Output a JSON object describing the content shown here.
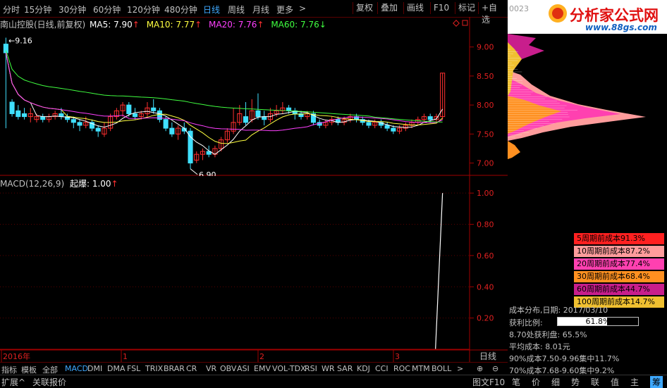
{
  "toolbar": {
    "periods": [
      "分时",
      "15分钟",
      "30分钟",
      "60分钟",
      "120分钟",
      "480分钟",
      "日线",
      "周线",
      "月线",
      "更多"
    ],
    "active_period": "日线",
    "buttons": [
      "复权",
      "叠加",
      "画线",
      "F10",
      "标记",
      "+自选"
    ],
    "code_partial": "0023"
  },
  "logo": {
    "text": "分析家公式网",
    "url": "www.88gs.com"
  },
  "main": {
    "title_name": "南山控股(日线,前复权)",
    "ma5": "MA5: 7.90",
    "ma10": "MA10: 7.77",
    "ma20": "MA20: 7.76",
    "ma60": "MA60: 7.76",
    "high_label": "9.16",
    "low_label": "6.90",
    "yaxis": [
      "9.00",
      "8.50",
      "8.00",
      "7.50",
      "7.00"
    ]
  },
  "macd": {
    "title": "MACD(12,26,9)",
    "indicator": "起爆: 1.00",
    "yaxis": [
      "1.00",
      "0.80",
      "0.60",
      "0.40",
      "0.20"
    ]
  },
  "dates": [
    "2016年",
    "1",
    "2",
    "3"
  ],
  "date_unit": "日线",
  "bottom_tabs": [
    "指标",
    "模板",
    "全部",
    "MACD",
    "DMI",
    "DMA",
    "FSL",
    "TRIX",
    "BRAR",
    "CR",
    "VR",
    "OBV",
    "ASI",
    "EMV",
    "VOL-TDX",
    "RSI",
    "WR",
    "SAR",
    "KDJ",
    "CCI",
    "ROC",
    "MTM",
    "BOLL"
  ],
  "active_tab": "MACD",
  "status_buttons": [
    "扩展^",
    "关联报价"
  ],
  "status_right": "图文F10",
  "right_tabs": [
    "笔",
    "价",
    "细",
    "势",
    "联",
    "值",
    "主",
    "筹"
  ],
  "active_right_tab": "筹",
  "cost_rows": [
    {
      "label": "5周期前成本91.3%",
      "color": "#ff2020"
    },
    {
      "label": "10周期前成本87.2%",
      "color": "#ff9c9c"
    },
    {
      "label": "20周期前成本77.4%",
      "color": "#ff40b0"
    },
    {
      "label": "30周期前成本68.4%",
      "color": "#ff9020"
    },
    {
      "label": "60周期前成本44.7%",
      "color": "#c81e8c"
    },
    {
      "label": "100周期前成本14.7%",
      "color": "#f0c030"
    }
  ],
  "cost_info": {
    "date": "成本分布,日期: 2017/03/10",
    "ratio_label": "获利比例:",
    "ratio_value": "61.8%",
    "ratio_fraction": 0.618,
    "profit": "8.70处获利盘: 65.5%",
    "avg": "平均成本: 8.01元",
    "c90": "90%成本7.50-9.96集中11.7%",
    "c70": "70%成本7.68-9.60集中9.2%"
  },
  "colors": {
    "up": "#ff3030",
    "down": "#40e0ff",
    "ma5": "#ffffff",
    "ma10": "#ffff40",
    "ma20": "#ff40ff",
    "ma60": "#40ff40",
    "axis": "#a00000"
  },
  "chart_data": {
    "type": "candlestick",
    "ylim": [
      6.8,
      9.3
    ],
    "candles": [
      [
        9.05,
        8.9,
        9.16,
        7.6
      ],
      [
        8.05,
        7.85,
        8.1,
        7.8
      ],
      [
        7.9,
        7.8,
        8.0,
        7.75
      ],
      [
        7.85,
        7.8,
        7.95,
        7.75
      ],
      [
        7.8,
        7.85,
        7.95,
        7.7
      ],
      [
        7.75,
        7.8,
        7.85,
        7.7
      ],
      [
        7.8,
        7.75,
        7.85,
        7.7
      ],
      [
        7.75,
        7.8,
        7.85,
        7.7
      ],
      [
        7.8,
        7.85,
        7.9,
        7.75
      ],
      [
        7.85,
        7.8,
        7.95,
        7.75
      ],
      [
        7.8,
        7.75,
        7.85,
        7.7
      ],
      [
        7.75,
        7.7,
        7.8,
        7.6
      ],
      [
        7.7,
        7.65,
        7.75,
        7.55
      ],
      [
        7.65,
        7.7,
        7.8,
        7.6
      ],
      [
        7.7,
        7.6,
        7.75,
        7.55
      ],
      [
        7.6,
        7.55,
        7.65,
        7.45
      ],
      [
        7.5,
        7.6,
        7.7,
        7.45
      ],
      [
        7.6,
        7.8,
        7.85,
        7.55
      ],
      [
        7.8,
        7.9,
        7.95,
        7.75
      ],
      [
        7.9,
        8.0,
        8.05,
        7.8
      ],
      [
        8.0,
        7.85,
        8.05,
        7.8
      ],
      [
        7.85,
        7.8,
        7.95,
        7.75
      ],
      [
        7.8,
        7.85,
        7.9,
        7.75
      ],
      [
        7.85,
        7.95,
        8.05,
        7.8
      ],
      [
        7.95,
        7.9,
        8.1,
        7.85
      ],
      [
        7.9,
        7.75,
        7.95,
        7.7
      ],
      [
        7.75,
        7.6,
        7.8,
        7.55
      ],
      [
        7.6,
        7.5,
        7.7,
        7.45
      ],
      [
        7.5,
        7.6,
        7.65,
        7.4
      ],
      [
        7.6,
        7.55,
        7.7,
        7.5
      ],
      [
        7.55,
        7.0,
        7.6,
        6.9
      ],
      [
        7.05,
        7.15,
        7.2,
        7.0
      ],
      [
        7.15,
        7.2,
        7.25,
        7.05
      ],
      [
        7.2,
        7.15,
        7.3,
        7.1
      ],
      [
        7.15,
        7.25,
        7.3,
        7.1
      ],
      [
        7.25,
        7.4,
        7.45,
        7.2
      ],
      [
        7.4,
        7.55,
        7.6,
        7.35
      ],
      [
        7.55,
        7.7,
        7.95,
        7.5
      ],
      [
        7.7,
        7.85,
        8.0,
        7.65
      ],
      [
        7.8,
        7.7,
        8.05,
        7.65
      ],
      [
        7.75,
        7.9,
        8.1,
        7.7
      ],
      [
        7.9,
        7.8,
        8.2,
        7.75
      ],
      [
        7.8,
        7.75,
        7.9,
        7.65
      ],
      [
        7.75,
        7.85,
        7.95,
        7.7
      ],
      [
        7.85,
        7.9,
        8.0,
        7.8
      ],
      [
        7.9,
        7.95,
        8.05,
        7.85
      ],
      [
        7.95,
        7.9,
        8.0,
        7.85
      ],
      [
        7.9,
        7.85,
        7.95,
        7.75
      ],
      [
        7.85,
        7.8,
        7.9,
        7.75
      ],
      [
        7.8,
        7.85,
        7.9,
        7.75
      ],
      [
        7.85,
        7.7,
        7.9,
        7.65
      ],
      [
        7.7,
        7.65,
        7.75,
        7.6
      ],
      [
        7.65,
        7.7,
        7.75,
        7.6
      ],
      [
        7.7,
        7.75,
        7.8,
        7.65
      ],
      [
        7.75,
        7.7,
        7.8,
        7.65
      ],
      [
        7.7,
        7.75,
        7.8,
        7.65
      ],
      [
        7.75,
        7.8,
        7.85,
        7.7
      ],
      [
        7.8,
        7.75,
        7.85,
        7.7
      ],
      [
        7.75,
        7.7,
        7.8,
        7.65
      ],
      [
        7.7,
        7.65,
        7.75,
        7.6
      ],
      [
        7.65,
        7.7,
        7.75,
        7.6
      ],
      [
        7.7,
        7.65,
        7.75,
        7.6
      ],
      [
        7.65,
        7.6,
        7.7,
        7.55
      ],
      [
        7.6,
        7.55,
        7.65,
        7.5
      ],
      [
        7.55,
        7.6,
        7.65,
        7.5
      ],
      [
        7.6,
        7.65,
        7.7,
        7.55
      ],
      [
        7.65,
        7.7,
        7.75,
        7.6
      ],
      [
        7.7,
        7.75,
        7.8,
        7.65
      ],
      [
        7.75,
        7.8,
        7.85,
        7.7
      ],
      [
        7.8,
        7.75,
        7.85,
        7.7
      ],
      [
        7.75,
        7.8,
        7.85,
        7.7
      ],
      [
        7.8,
        8.55,
        8.55,
        7.75
      ]
    ],
    "macd_signal": {
      "index": 71,
      "value": 1.0
    },
    "macd_ylim": [
      0,
      1.1
    ]
  }
}
